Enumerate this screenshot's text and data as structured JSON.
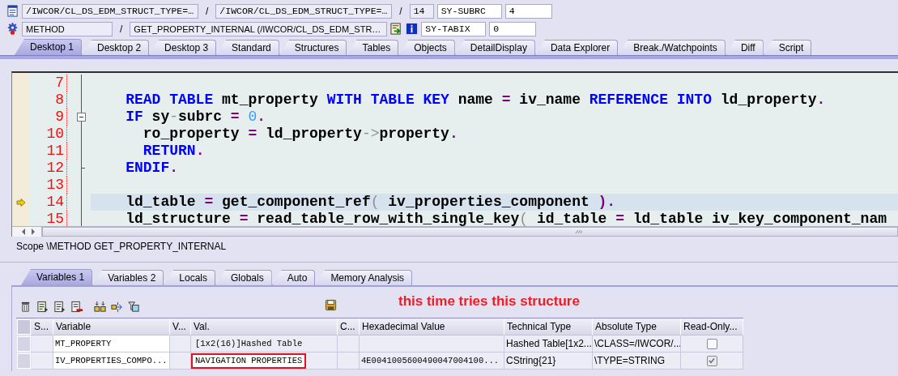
{
  "header": {
    "program_row": {
      "program": "/IWCOR/CL_DS_EDM_STRUCT_TYPE=…",
      "separator_1": "/",
      "include": "/IWCOR/CL_DS_EDM_STRUCT_TYPE=…",
      "separator_2": "/",
      "line": "14",
      "system_field": "SY-SUBRC",
      "system_value": "4"
    },
    "event_row": {
      "event_type": "METHOD",
      "separator": "/",
      "event": "GET_PROPERTY_INTERNAL (/IWCOR/CL_DS_EDM_STR…",
      "system_field": "SY-TABIX",
      "system_value": "0"
    }
  },
  "desktop_tabs": [
    {
      "label": "Desktop 1",
      "selected": true
    },
    {
      "label": "Desktop 2",
      "selected": false
    },
    {
      "label": "Desktop 3",
      "selected": false
    },
    {
      "label": "Standard",
      "selected": false
    },
    {
      "label": "Structures",
      "selected": false
    },
    {
      "label": "Tables",
      "selected": false
    },
    {
      "label": "Objects",
      "selected": false
    },
    {
      "label": "DetailDisplay",
      "selected": false
    },
    {
      "label": "Data Explorer",
      "selected": false
    },
    {
      "label": "Break./Watchpoints",
      "selected": false
    },
    {
      "label": "Diff",
      "selected": false
    },
    {
      "label": "Script",
      "selected": false
    }
  ],
  "code": {
    "lines": [
      {
        "number": "7",
        "current": false,
        "fold": false,
        "fold_end": false
      },
      {
        "number": "8",
        "current": false,
        "fold": false,
        "fold_end": false,
        "tokens": [
          {
            "kind": "kw",
            "text": "    READ TABLE"
          },
          {
            "kind": "id",
            "text": " mt_property "
          },
          {
            "kind": "kw",
            "text": "WITH TABLE KEY"
          },
          {
            "kind": "id",
            "text": " name "
          },
          {
            "kind": "op",
            "text": "="
          },
          {
            "kind": "id",
            "text": " iv_name "
          },
          {
            "kind": "kw",
            "text": "REFERENCE INTO"
          },
          {
            "kind": "id",
            "text": " ld_property"
          },
          {
            "kind": "op",
            "text": "."
          }
        ]
      },
      {
        "number": "9",
        "current": false,
        "fold": true,
        "fold_end": false,
        "tokens": [
          {
            "kind": "kw",
            "text": "    IF"
          },
          {
            "kind": "id",
            "text": " sy"
          },
          {
            "kind": "sym",
            "text": "-"
          },
          {
            "kind": "id",
            "text": "subrc "
          },
          {
            "kind": "op",
            "text": "="
          },
          {
            "kind": "num",
            "text": " 0"
          },
          {
            "kind": "op",
            "text": "."
          }
        ]
      },
      {
        "number": "10",
        "current": false,
        "fold": false,
        "fold_end": false,
        "tokens": [
          {
            "kind": "id",
            "text": "      ro_property "
          },
          {
            "kind": "op",
            "text": "="
          },
          {
            "kind": "id",
            "text": " ld_property"
          },
          {
            "kind": "sym",
            "text": "->"
          },
          {
            "kind": "id",
            "text": "property"
          },
          {
            "kind": "op",
            "text": "."
          }
        ]
      },
      {
        "number": "11",
        "current": false,
        "fold": false,
        "fold_end": false,
        "tokens": [
          {
            "kind": "kw",
            "text": "      RETURN"
          },
          {
            "kind": "op",
            "text": "."
          }
        ]
      },
      {
        "number": "12",
        "current": false,
        "fold": false,
        "fold_end": true,
        "tokens": [
          {
            "kind": "kw",
            "text": "    ENDIF"
          },
          {
            "kind": "op",
            "text": "."
          }
        ]
      },
      {
        "number": "13",
        "current": false,
        "fold": false,
        "fold_end": false
      },
      {
        "number": "14",
        "current": true,
        "fold": false,
        "fold_end": false,
        "tokens": [
          {
            "kind": "id",
            "text": "    ld_table "
          },
          {
            "kind": "op",
            "text": "="
          },
          {
            "kind": "id",
            "text": " get_component_ref"
          },
          {
            "kind": "sym",
            "text": "("
          },
          {
            "kind": "id",
            "text": " iv_properties_component "
          },
          {
            "kind": "op",
            "text": ")"
          },
          {
            "kind": "op",
            "text": "."
          }
        ]
      },
      {
        "number": "15",
        "current": false,
        "fold": false,
        "fold_end": false,
        "tokens": [
          {
            "kind": "id",
            "text": "    ld_structure "
          },
          {
            "kind": "op",
            "text": "="
          },
          {
            "kind": "id",
            "text": " read_table_row_with_single_key"
          },
          {
            "kind": "sym",
            "text": "("
          },
          {
            "kind": "id",
            "text": " id_table "
          },
          {
            "kind": "op",
            "text": "="
          },
          {
            "kind": "id",
            "text": " ld_table iv_key_component_nam"
          }
        ]
      }
    ]
  },
  "scope": "Scope \\METHOD GET_PROPERTY_INTERNAL",
  "variable_tabs": [
    {
      "label": "Variables 1",
      "selected": true
    },
    {
      "label": "Variables 2",
      "selected": false
    },
    {
      "label": "Locals",
      "selected": false
    },
    {
      "label": "Globals",
      "selected": false
    },
    {
      "label": "Auto",
      "selected": false
    },
    {
      "label": "Memory Analysis",
      "selected": false
    }
  ],
  "annotation": "this time tries this structure",
  "table": {
    "columns": [
      "S...",
      "Variable",
      "V...",
      "Val.",
      "C...",
      "Hexadecimal Value",
      "Technical Type",
      "Absolute Type",
      "Read-Only..."
    ],
    "rows": [
      {
        "variable": "MT_PROPERTY",
        "value": "[1x2(16)]Hashed Table",
        "value_marked": false,
        "technical_type": "Hashed Table[1x2...",
        "absolute_type": "\\CLASS=/IWCOR/...",
        "read_only": false
      },
      {
        "variable": "IV_PROPERTIES_COMPO...",
        "value": "NAVIGATION PROPERTIES",
        "value_marked": true,
        "hex": "4E0041005600490047004100...",
        "technical_type": "CString{21}",
        "absolute_type": "\\TYPE=STRING",
        "read_only": true
      }
    ]
  }
}
